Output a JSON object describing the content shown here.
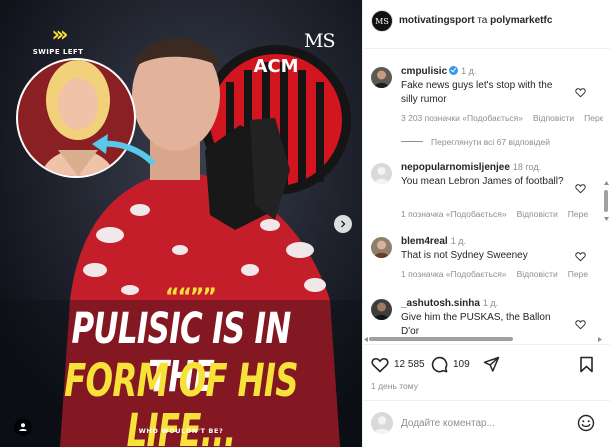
{
  "post_image": {
    "swipe_label": "SWIPE LEFT",
    "swipe_chevrons": "›››",
    "brand_mark": "MS",
    "club_letters": "ACM",
    "quote_marks": "““””",
    "headline_line1": "PULISIC IS IN THE",
    "headline_line2": "FORM OF HIS LIFE...",
    "tagline": "WHO WOULDN'T BE?",
    "colors": {
      "accent_yellow": "#f7e23a",
      "arrow_cyan": "#59c8ea",
      "club_red": "#d2151f",
      "headline_white": "#ffffff"
    }
  },
  "header": {
    "avatar_text": "MS",
    "author": "motivatingsport",
    "conjunction": "та",
    "collaborator": "polymarketfc"
  },
  "comments": [
    {
      "user": "cmpulisic",
      "verified": true,
      "age": "1 д.",
      "text": "Fake news guys let's stop with the silly rumor",
      "likes_label": "3 203 позначки «Подобається»",
      "reply_label": "Відповісти",
      "more_label": "Пере",
      "view_replies": "Переглянути всі 67 відповідей"
    },
    {
      "user": "nepopularnomisljenjee",
      "verified": false,
      "age": "18 год.",
      "text": "You mean Lebron James of football?",
      "likes_label": "1 позначка «Подобається»",
      "reply_label": "Відповісти",
      "more_label": "Пере"
    },
    {
      "user": "blem4real",
      "verified": false,
      "age": "1 д.",
      "text": "That is not Sydney Sweeney",
      "likes_label": "1 позначка «Подобається»",
      "reply_label": "Відповісти",
      "more_label": "Пере"
    },
    {
      "user": "_ashutosh.sinha",
      "verified": false,
      "age": "1 д.",
      "text": "Give him the PUSKAS, the Ballon D'or"
    }
  ],
  "actions": {
    "like_count": "12 585",
    "comment_count": "109",
    "icons": [
      "heart-icon",
      "comment-icon",
      "share-icon",
      "bookmark-icon"
    ]
  },
  "post_time": "1 день тому",
  "composer": {
    "placeholder": "Додайте коментар...",
    "emoji_icon": "smile-icon"
  }
}
